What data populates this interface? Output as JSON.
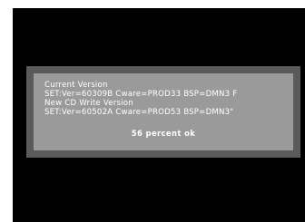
{
  "dialog": {
    "current_version_label": "Current Version",
    "current_version_value": "SET:Ver=60309B Cware=PROD33 BSP=DMN3 F",
    "new_version_label": "New CD Write Version",
    "new_version_value": "SET:Ver=60502A Cware=PROD53 BSP=DMN3\"",
    "progress_text": "56 percent ok"
  },
  "colors": {
    "screen_background": "#000000",
    "dialog_border": "#5a5a5a",
    "dialog_fill": "#9a9a9a",
    "text": "#ffffff"
  }
}
